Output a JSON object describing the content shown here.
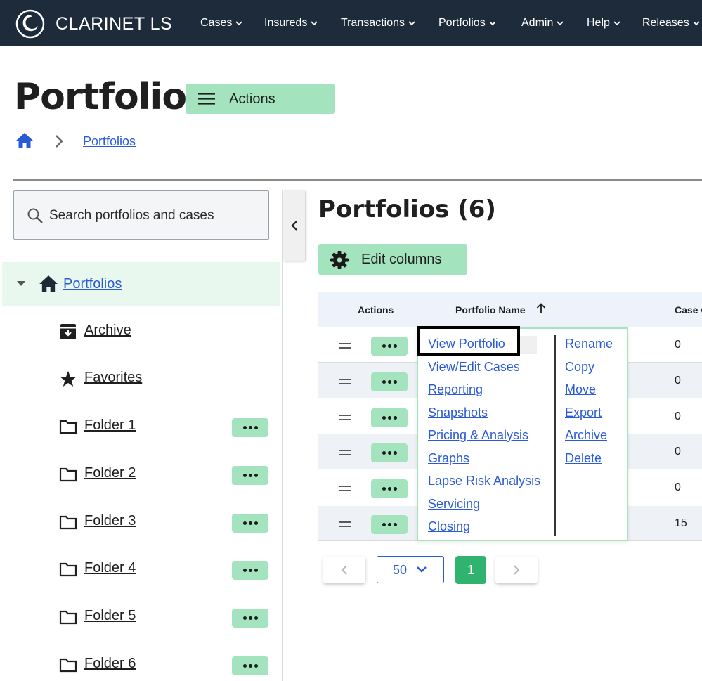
{
  "app": {
    "brand": "CLARINET LS"
  },
  "nav": [
    {
      "label": "Cases"
    },
    {
      "label": "Insureds"
    },
    {
      "label": "Transactions"
    },
    {
      "label": "Portfolios"
    },
    {
      "label": "Admin"
    },
    {
      "label": "Help"
    },
    {
      "label": "Releases"
    }
  ],
  "header": {
    "title": "Portfolios",
    "actions_label": "Actions"
  },
  "breadcrumb": {
    "current": "Portfolios"
  },
  "sidebar": {
    "search_placeholder": "Search portfolios and cases",
    "root": "Portfolios",
    "items": [
      {
        "label": "Archive",
        "icon": "archive-icon"
      },
      {
        "label": "Favorites",
        "icon": "star-icon"
      },
      {
        "label": "Folder 1",
        "icon": "folder-icon"
      },
      {
        "label": "Folder 2",
        "icon": "folder-icon"
      },
      {
        "label": "Folder 3",
        "icon": "folder-icon"
      },
      {
        "label": "Folder 4",
        "icon": "folder-icon"
      },
      {
        "label": "Folder 5",
        "icon": "folder-icon"
      },
      {
        "label": "Folder 6",
        "icon": "folder-icon"
      }
    ]
  },
  "main": {
    "title": "Portfolios (6)",
    "edit_columns_label": "Edit columns",
    "table": {
      "columns": [
        "Actions",
        "Portfolio Name",
        "Case Count"
      ],
      "rows": [
        {
          "count": "0"
        },
        {
          "count": "0"
        },
        {
          "count": "0"
        },
        {
          "count": "0"
        },
        {
          "count": "0"
        },
        {
          "count": "15"
        }
      ]
    },
    "context_menu": {
      "left": [
        "View Portfolio",
        "View/Edit Cases",
        "Reporting",
        "Snapshots",
        "Pricing & Analysis",
        "Graphs",
        "Lapse Risk Analysis",
        "Servicing",
        "Closing"
      ],
      "right": [
        "Rename",
        "Copy",
        "Move",
        "Export",
        "Archive",
        "Delete"
      ]
    },
    "pagination": {
      "page_size": "50",
      "current_page": "1"
    }
  },
  "colors": {
    "topbar": "#1d2b3a",
    "accent_green": "#a3e4bf",
    "link_blue": "#2a5bd7",
    "page_active": "#2fb36e"
  }
}
